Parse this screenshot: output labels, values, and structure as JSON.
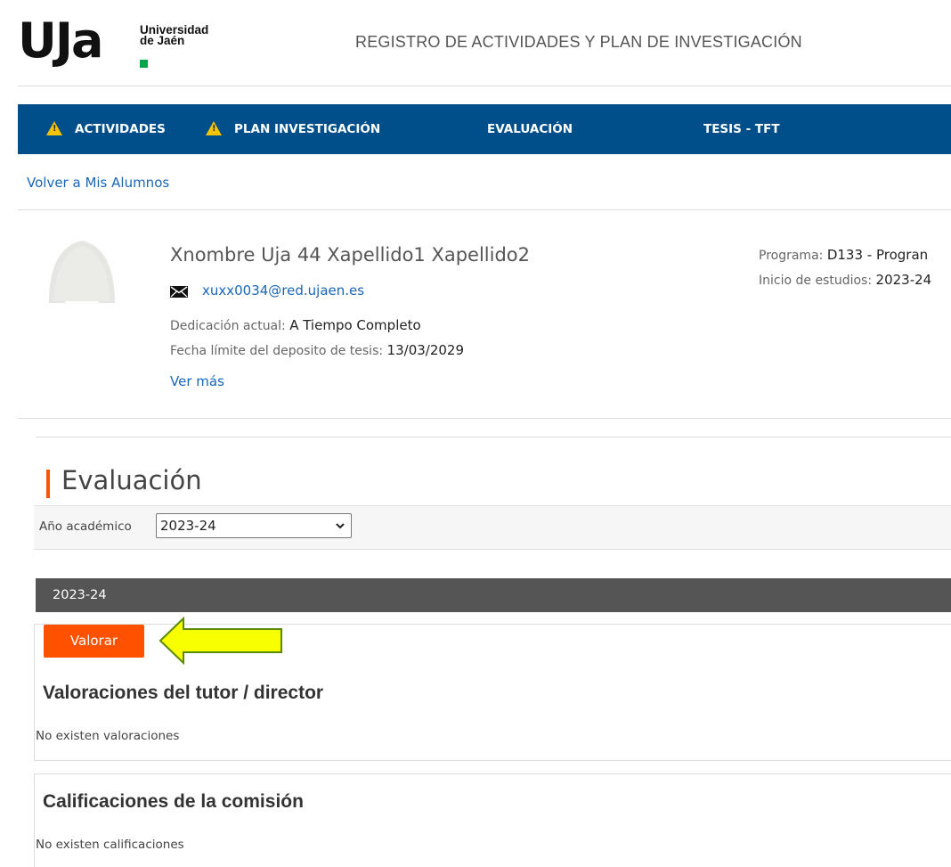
{
  "header": {
    "logo_mark": "UJa",
    "logo_line1": "Universidad",
    "logo_line2": "de Jaén",
    "app_title": "REGISTRO DE ACTIVIDADES Y PLAN DE INVESTIGACIÓN"
  },
  "nav": {
    "items": [
      {
        "label": "ACTIVIDADES",
        "warning": true
      },
      {
        "label": "PLAN INVESTIGACIÓN",
        "warning": true
      },
      {
        "label": "EVALUACIÓN",
        "warning": false
      },
      {
        "label": "TESIS - TFT",
        "warning": false
      }
    ]
  },
  "back_link": "Volver a Mis Alumnos",
  "student": {
    "name": "Xnombre Uja 44 Xapellido1 Xapellido2",
    "email": "xuxx0034@red.ujaen.es",
    "dedicacion_label": "Dedicación actual:",
    "dedicacion_value": "A Tiempo Completo",
    "fecha_label": "Fecha límite del deposito de tesis:",
    "fecha_value": "13/03/2029",
    "ver_mas": "Ver más",
    "programa_label": "Programa:",
    "programa_value": "D133 - Progran",
    "inicio_label": "Inicio de estudios:",
    "inicio_value": "2023-24"
  },
  "evaluacion": {
    "title": "Evaluación",
    "year_label": "Año académico",
    "year_selected": "2023-24",
    "year_header": "2023-24",
    "valorar_button": "Valorar",
    "valoraciones_title": "Valoraciones del tutor / director",
    "valoraciones_empty": "No existen valoraciones",
    "calificaciones_title": "Calificaciones de la comisión",
    "calificaciones_empty": "No existen calificaciones"
  },
  "colors": {
    "nav_blue": "#004f8b",
    "accent_orange": "#ff5100",
    "link_blue": "#1a66b8",
    "warning_yellow": "#f5c400",
    "annotation_arrow": "#f7ff00"
  }
}
